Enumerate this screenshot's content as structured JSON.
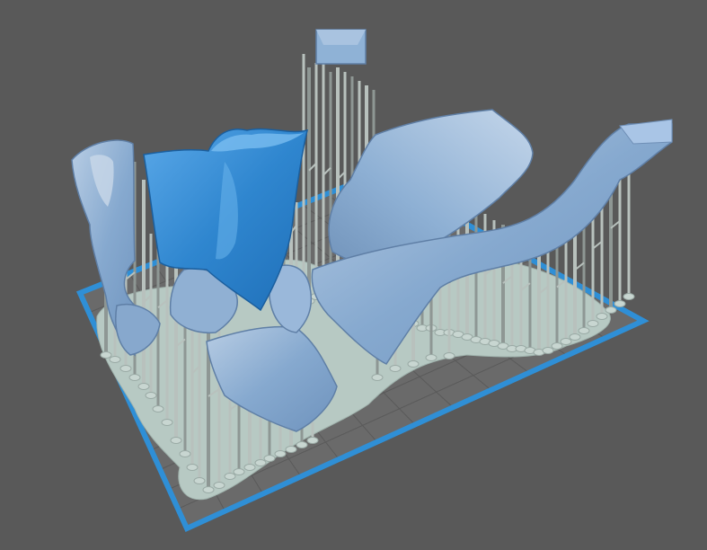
{
  "viewport": {
    "mode": "3d-print-preview",
    "background": "#595959",
    "build_plate": {
      "border_color": "#2f8fd6",
      "fill_color": "#6a6a6a",
      "grid_color": "#5a5a5a",
      "grid_lines": 12
    },
    "raft_color": "#b9cbc5",
    "support_color": "#b8c1bd",
    "support_shadow": "#8e9794",
    "objects": [
      {
        "name": "selected-model",
        "color": "#3a8fd4",
        "selected": true
      },
      {
        "name": "model",
        "color": "#8fb2d6",
        "selected": false
      }
    ]
  }
}
